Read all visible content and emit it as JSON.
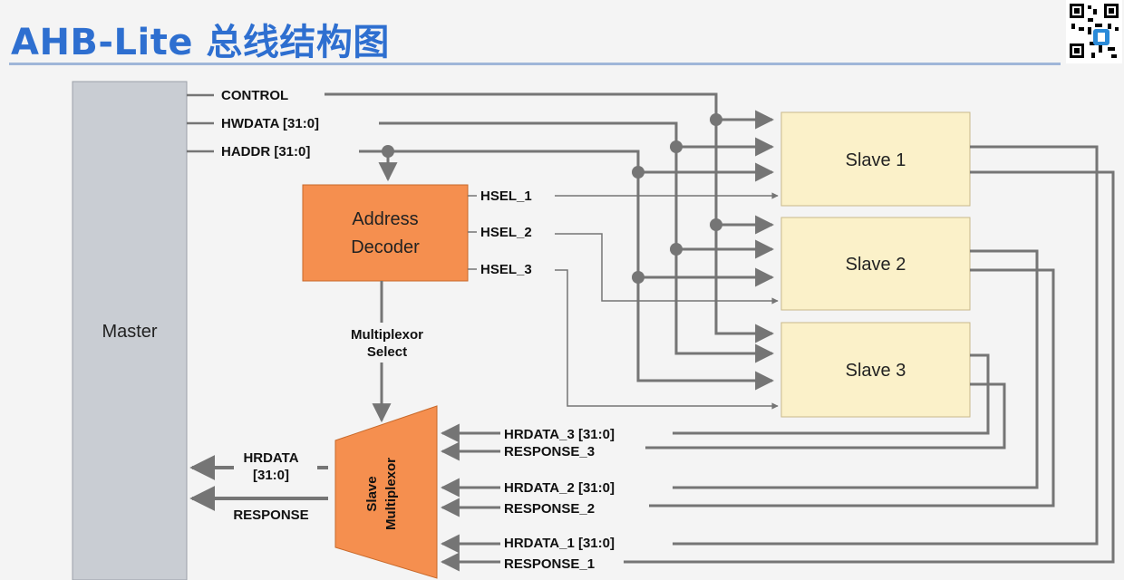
{
  "header": {
    "title": "AHB-Lite 总线结构图"
  },
  "blocks": {
    "master": "Master",
    "decoder_line1": "Address",
    "decoder_line2": "Decoder",
    "slave1": "Slave 1",
    "slave2": "Slave 2",
    "slave3": "Slave 3",
    "mux_line1": "Slave",
    "mux_line2": "Multiplexor"
  },
  "signals": {
    "control": "CONTROL",
    "hwdata": "HWDATA [31:0]",
    "haddr": "HADDR [31:0]",
    "hsel_1": "HSEL_1",
    "hsel_2": "HSEL_2",
    "hsel_3": "HSEL_3",
    "mux_select_line1": "Multiplexor",
    "mux_select_line2": "Select",
    "hrdata_line1": "HRDATA",
    "hrdata_line2": "[31:0]",
    "response": "RESPONSE",
    "hrdata_3": "HRDATA_3 [31:0]",
    "response_3": "RESPONSE_3",
    "hrdata_2": "HRDATA_2 [31:0]",
    "response_2": "RESPONSE_2",
    "hrdata_1": "HRDATA_1 [31:0]",
    "response_1": "RESPONSE_1"
  },
  "colors": {
    "title": "#2e6fd0",
    "master_fill": "#c9cdd3",
    "decoder_fill": "#f58f4f",
    "slave_fill": "#fbf1c9",
    "wire": "#757575"
  },
  "icons": {
    "qr": "qr-code-icon"
  }
}
